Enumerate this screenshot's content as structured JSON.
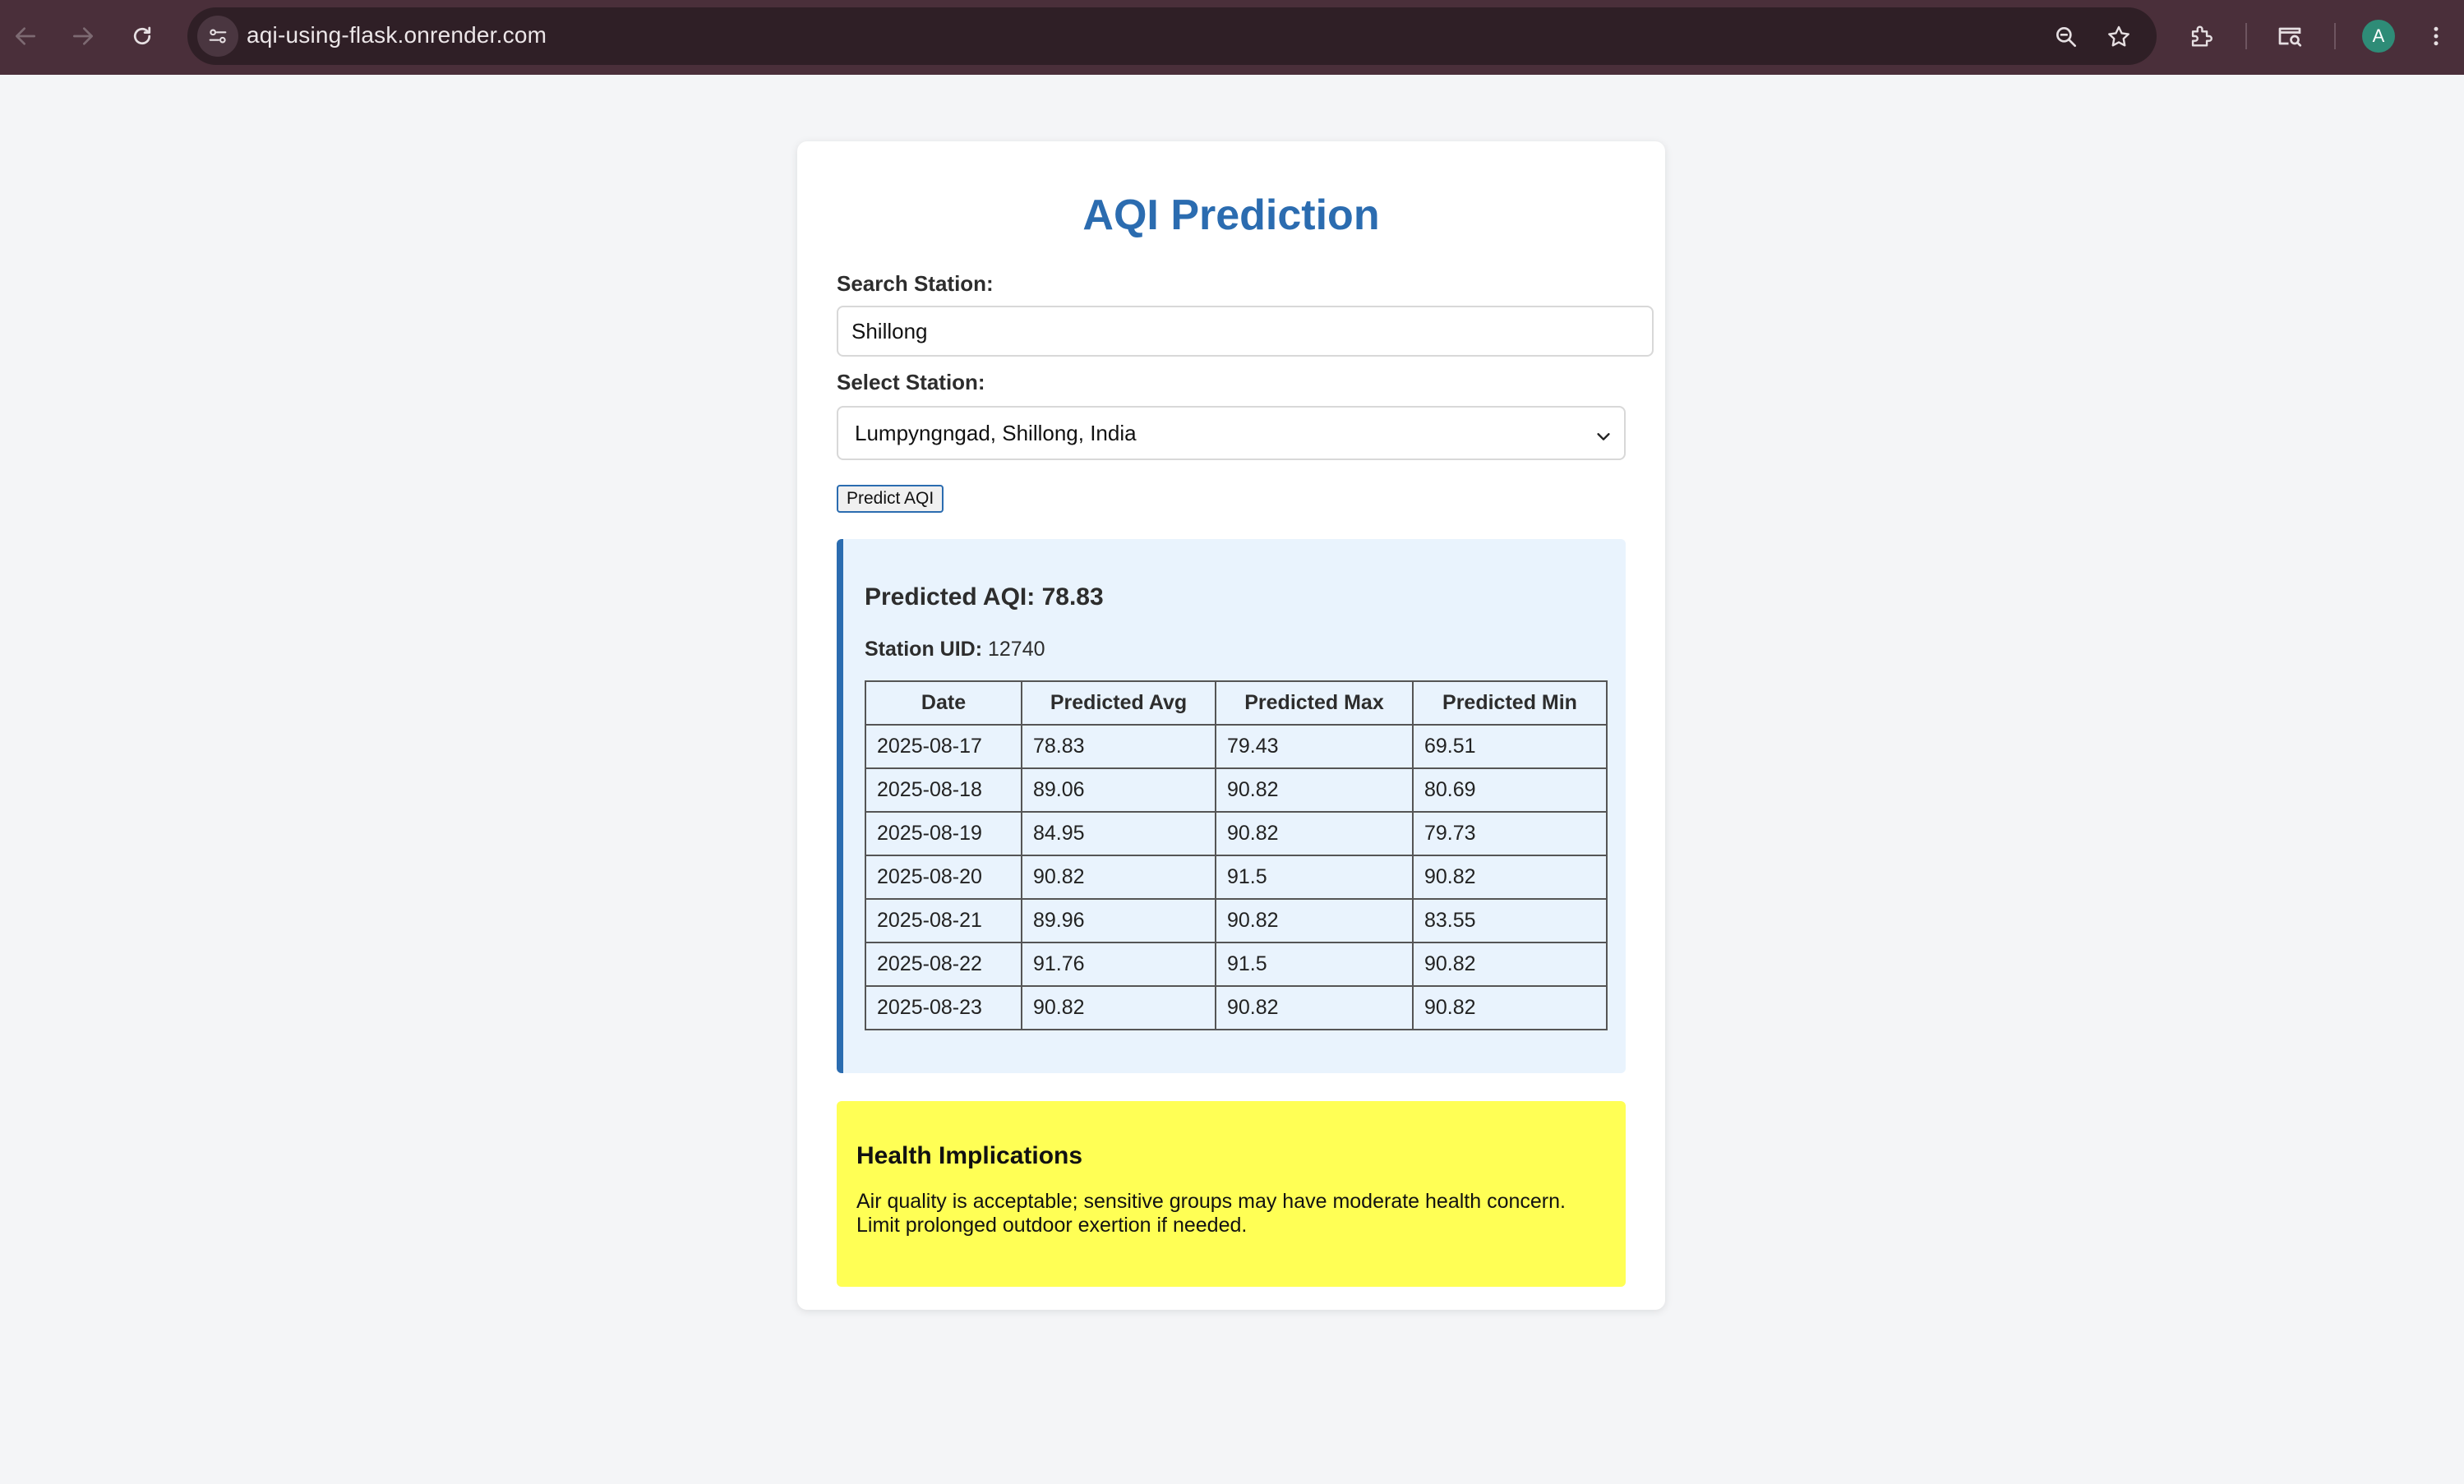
{
  "browser": {
    "url": "aqi-using-flask.onrender.com",
    "profile_initial": "A",
    "icons": [
      "back-icon",
      "forward-icon",
      "reload-icon",
      "site-settings-icon",
      "zoom-icon",
      "bookmark-star-icon",
      "extensions-icon",
      "tab-search-icon",
      "more-menu-icon"
    ]
  },
  "page": {
    "title": "AQI Prediction",
    "search_label": "Search Station:",
    "search_value": "Shillong",
    "select_label": "Select Station:",
    "select_value": "Lumpyngngad, Shillong, India",
    "predict_button": "Predict AQI"
  },
  "result": {
    "predicted_text": "Predicted AQI: 78.83",
    "uid_label": "Station UID:",
    "uid_value": "12740",
    "columns": [
      "Date",
      "Predicted Avg",
      "Predicted Max",
      "Predicted Min"
    ],
    "rows": [
      [
        "2025-08-17",
        "78.83",
        "79.43",
        "69.51"
      ],
      [
        "2025-08-18",
        "89.06",
        "90.82",
        "80.69"
      ],
      [
        "2025-08-19",
        "84.95",
        "90.82",
        "79.73"
      ],
      [
        "2025-08-20",
        "90.82",
        "91.5",
        "90.82"
      ],
      [
        "2025-08-21",
        "89.96",
        "90.82",
        "83.55"
      ],
      [
        "2025-08-22",
        "91.76",
        "91.5",
        "90.82"
      ],
      [
        "2025-08-23",
        "90.82",
        "90.82",
        "90.82"
      ]
    ]
  },
  "health": {
    "title": "Health Implications",
    "text": "Air quality is acceptable; sensitive groups may have moderate health concern. Limit prolonged outdoor exertion if needed."
  },
  "colors": {
    "accent": "#2b6cb0",
    "result_bg": "#e9f3fd",
    "health_bg": "#ffff55",
    "chrome_bg": "#4a2f3a"
  }
}
